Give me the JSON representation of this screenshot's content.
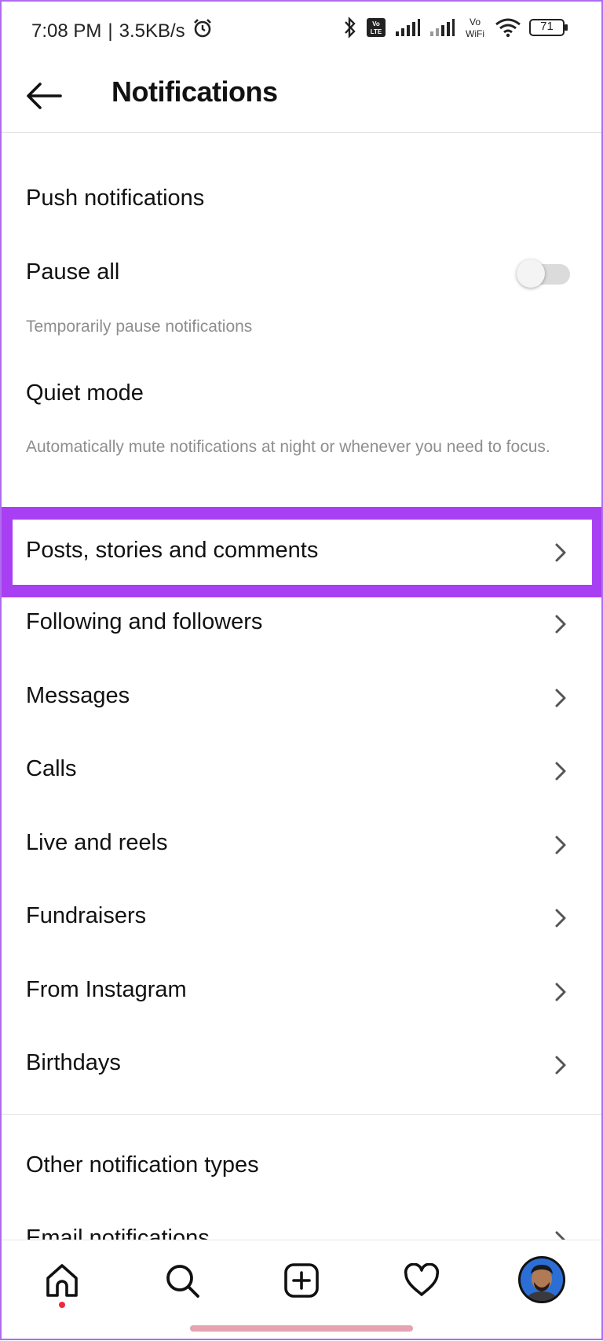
{
  "status_bar": {
    "time": "7:08 PM",
    "speed": "3.5KB/s",
    "battery": "71",
    "icons": [
      "alarm-icon",
      "bluetooth-icon",
      "volte-icon",
      "signal-icon",
      "signal-icon",
      "vowifi-icon",
      "wifi-icon",
      "battery-icon"
    ],
    "separator": "|",
    "volte_label": "Vo LTE",
    "vowifi_label_top": "Vo",
    "vowifi_label_bottom": "WiFi"
  },
  "header": {
    "title": "Notifications",
    "back_icon": "back-arrow-icon"
  },
  "push": {
    "section_title": "Push notifications",
    "pause_all": {
      "label": "Pause all",
      "description": "Temporarily pause notifications",
      "enabled": false
    },
    "quiet_mode": {
      "label": "Quiet mode",
      "description": "Automatically mute notifications at night or whenever you need to focus."
    }
  },
  "categories": [
    {
      "label": "Posts, stories and comments",
      "highlighted": true
    },
    {
      "label": "Following and followers"
    },
    {
      "label": "Messages"
    },
    {
      "label": "Calls"
    },
    {
      "label": "Live and reels"
    },
    {
      "label": "Fundraisers"
    },
    {
      "label": "From Instagram"
    },
    {
      "label": "Birthdays"
    }
  ],
  "other": {
    "section_title": "Other notification types",
    "email_label": "Email notifications"
  },
  "bottom_nav": {
    "items": [
      "home-icon",
      "search-icon",
      "create-icon",
      "activity-heart-icon",
      "profile-avatar"
    ],
    "home_has_badge": true
  },
  "colors": {
    "highlight": "#a93ff2",
    "text": "#111111",
    "secondary_text": "#8e8e8e",
    "badge": "#ed2a3c"
  }
}
